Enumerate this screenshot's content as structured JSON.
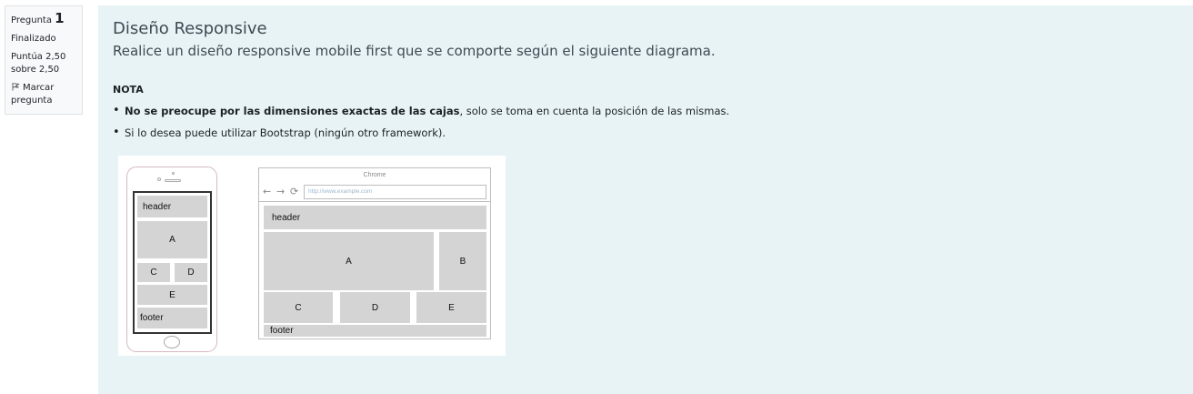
{
  "question_info": {
    "label": "Pregunta",
    "number": "1",
    "state": "Finalizado",
    "grade_line1": "Puntúa 2,50",
    "grade_line2": "sobre 2,50",
    "flag_line1": "Marcar",
    "flag_line2": "pregunta",
    "flag_icon": "flag-icon"
  },
  "question": {
    "title": "Diseño Responsive",
    "subtitle": "Realice un diseño responsive mobile first que se comporte según el siguiente diagrama.",
    "note_heading": "NOTA",
    "bullets": [
      {
        "bold": "No se preocupe por las dimensiones exactas de las cajas",
        "text": ", solo se toma en cuenta la posición de las mismas."
      },
      {
        "bold": "",
        "text": "Si lo desea puede utilizar Bootstrap (ningún otro framework)."
      }
    ]
  },
  "diagram": {
    "mobile": {
      "header": "header",
      "a": "A",
      "c": "C",
      "d": "D",
      "e": "E",
      "footer": "footer"
    },
    "desktop": {
      "browser_title": "Chrome",
      "nav_icons": [
        "back-arrow-icon",
        "forward-arrow-icon",
        "reload-icon"
      ],
      "url": "http://www.example.com",
      "header": "header",
      "a": "A",
      "b": "B",
      "c": "C",
      "d": "D",
      "e": "E",
      "footer": "footer"
    }
  },
  "colors": {
    "content_bg": "#e7f3f5",
    "box_fill": "#d4d4d4",
    "sidebar_bg": "#f8f9fa"
  }
}
